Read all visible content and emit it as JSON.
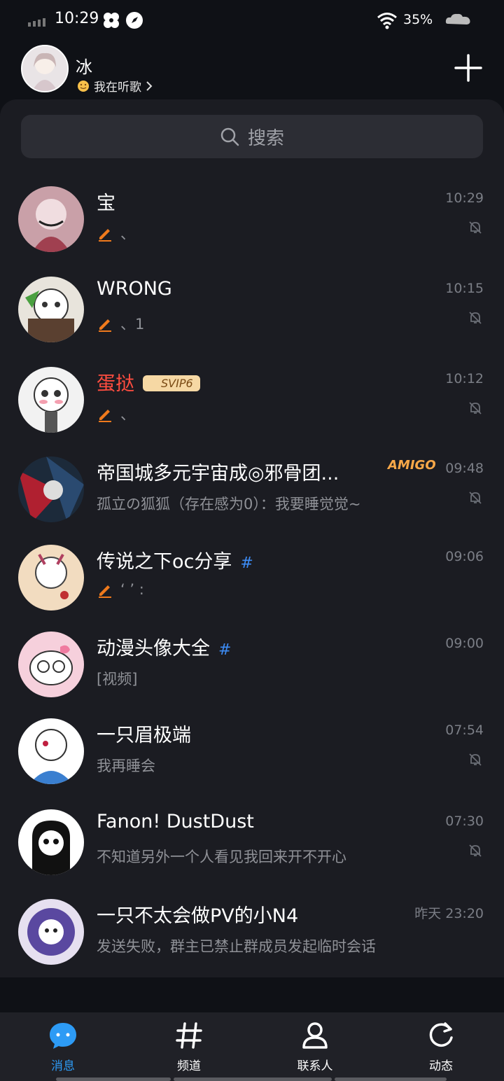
{
  "status_bar": {
    "time": "10:29",
    "battery": "35%"
  },
  "header": {
    "user_name": "冰",
    "user_status": "我在听歌"
  },
  "search": {
    "placeholder": "搜索"
  },
  "conversations": [
    {
      "name": "宝",
      "preview": "、",
      "time": "10:29",
      "muted": true,
      "draft": true
    },
    {
      "name": "WRONG",
      "preview": "、1",
      "time": "10:15",
      "muted": true,
      "draft": true
    },
    {
      "name": "蛋挞",
      "badge": "SVIP6",
      "preview": "、",
      "time": "10:12",
      "muted": true,
      "draft": true
    },
    {
      "name": "帝国城多元宇宙成◎邪骨团...",
      "tag": "AMIGO",
      "preview": "孤立の狐狐（存在感为0）：我要睡觉觉~",
      "time": "09:48",
      "muted": true
    },
    {
      "name": "传说之下oc分享",
      "preview": "‘ ’ :",
      "time": "09:06",
      "channel": true,
      "draft": true
    },
    {
      "name": "动漫头像大全",
      "preview": "[视频]",
      "time": "09:00",
      "channel": true
    },
    {
      "name": "一只眉极端",
      "preview": "我再睡会",
      "time": "07:54",
      "muted": true
    },
    {
      "name": "Fanon! DustDust",
      "preview": "不知道另外一个人看见我回来开不开心",
      "time": "07:30",
      "muted": true
    },
    {
      "name": "一只不太会做PV的小N4",
      "preview": "发送失败，群主已禁止群成员发起临时会话",
      "time": "昨天 23:20"
    }
  ],
  "nav": {
    "messages": "消息",
    "channels": "频道",
    "contacts": "联系人",
    "moments": "动态"
  },
  "colors": {
    "accent": "#2d9bf5",
    "draft": "#f07a1c",
    "vip_name": "#ff4d40"
  }
}
